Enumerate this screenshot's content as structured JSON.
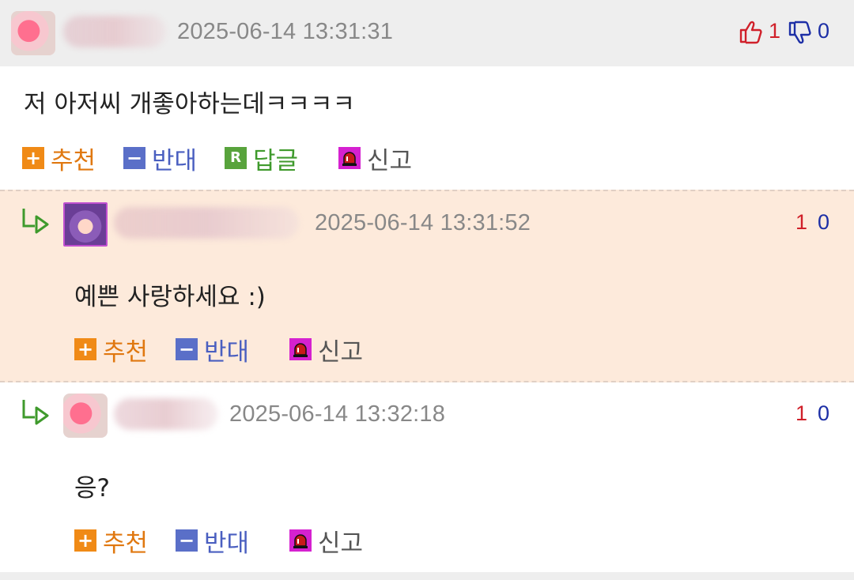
{
  "comments": [
    {
      "timestamp": "2025-06-14 13:31:31",
      "up": "1",
      "down": "0",
      "text": "저 아저씨 개좋아하는데ㅋㅋㅋㅋ",
      "actions": {
        "recommend": "추천",
        "oppose": "반대",
        "reply": "답글",
        "report": "신고"
      }
    },
    {
      "timestamp": "2025-06-14 13:31:52",
      "up": "1",
      "down": "0",
      "text": "예쁜 사랑하세요 :)",
      "actions": {
        "recommend": "추천",
        "oppose": "반대",
        "report": "신고"
      }
    },
    {
      "timestamp": "2025-06-14 13:32:18",
      "up": "1",
      "down": "0",
      "text": "응?",
      "actions": {
        "recommend": "추천",
        "oppose": "반대",
        "report": "신고"
      }
    }
  ],
  "icons": {
    "thumbs_up": "thumbs-up-icon",
    "thumbs_down": "thumbs-down-icon",
    "reply_arrow": "reply-arrow-icon",
    "plus": "plus-icon",
    "minus": "minus-icon",
    "reply": "reply-r-icon",
    "report": "siren-icon"
  },
  "colors": {
    "header_bg": "#eeeeee",
    "reply_bg": "#fdeadb",
    "recommend": "#f08a16",
    "oppose": "#5a6fc8",
    "reply": "#58a33c",
    "report": "#d521d0",
    "up": "#d0202a",
    "down": "#1d2fa6"
  }
}
